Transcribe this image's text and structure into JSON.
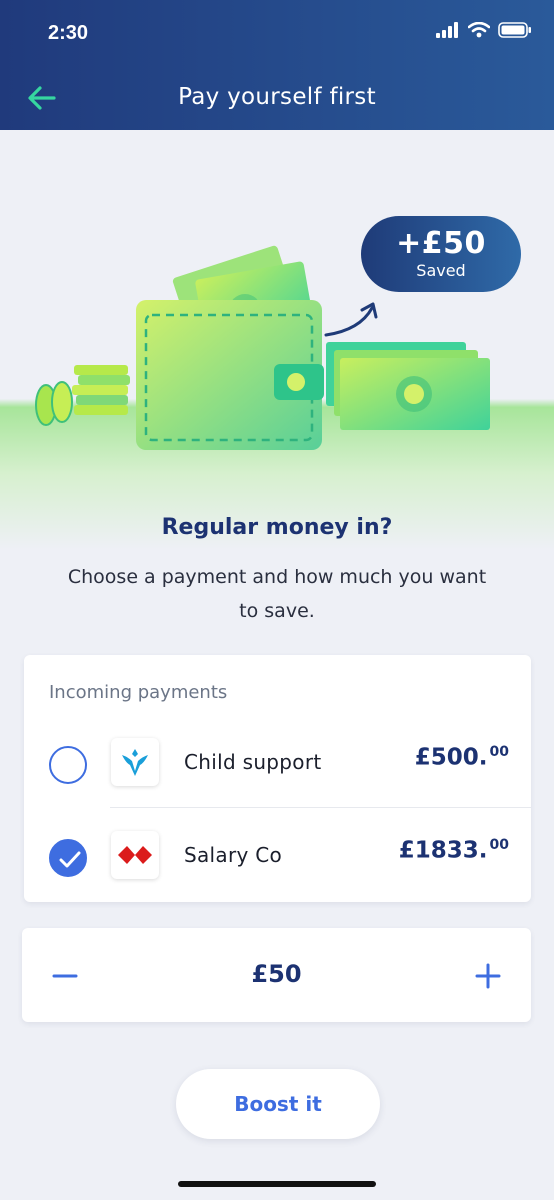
{
  "status_bar": {
    "time": "2:30"
  },
  "header": {
    "title": "Pay yourself first"
  },
  "hero": {
    "saved_amount": "+£50",
    "saved_label": "Saved"
  },
  "intro": {
    "heading": "Regular money in?",
    "subtext": "Choose a payment and how much you want to save."
  },
  "payments": {
    "label": "Incoming payments",
    "items": [
      {
        "name": "Child support",
        "amount": "£500.",
        "decimals": "00",
        "selected": false,
        "logo": "eagle-bank-icon",
        "logo_color": "#1a9fd9"
      },
      {
        "name": "Salary Co",
        "amount": "£1833.",
        "decimals": "00",
        "selected": true,
        "logo": "hexagon-bank-icon",
        "logo_color": "#db1b1b"
      }
    ]
  },
  "stepper": {
    "value": "£50"
  },
  "actions": {
    "boost_label": "Boost it"
  },
  "colors": {
    "accent": "#3e6de0",
    "header": "#203a7c",
    "heading": "#1c3272",
    "back_arrow": "#36d6a0"
  }
}
